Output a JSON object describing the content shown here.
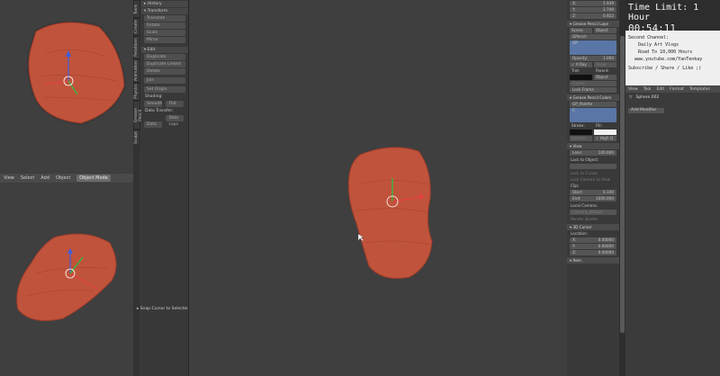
{
  "colors": {
    "mesh": "#c0533b",
    "mesh_dark": "#9e3c2a",
    "viewport": "#3f3f3f"
  },
  "header": {
    "items": [
      "View",
      "Select",
      "Add",
      "Object"
    ],
    "mode": "Object Mode"
  },
  "tabs": [
    "Tools",
    "Create",
    "Relations",
    "Animation",
    "Physics",
    "Grease Pencil",
    "Sculpt"
  ],
  "toolshelf": {
    "history": "History",
    "transform": "Transform",
    "transform_buttons": [
      "Translate",
      "Rotate",
      "Scale",
      "Mirror"
    ],
    "edit": "Edit",
    "edit_buttons": [
      "Duplicate",
      "Duplicate Linked",
      "Delete",
      "Join"
    ],
    "set_origin": "Set Origin",
    "shading": "Shading:",
    "shading_buttons": [
      "Smooth",
      "Flat"
    ],
    "data_transfer": "Data Transfer:",
    "data_buttons": [
      "Data",
      "Data Layo"
    ]
  },
  "snap": "Snap Cursor to Selected",
  "props": {
    "coords_top": [
      {
        "axis": "X:",
        "val": "1.939"
      },
      {
        "axis": "Y:",
        "val": "2.749"
      },
      {
        "axis": "Z:",
        "val": "0.922"
      }
    ],
    "gp_layers": "Grease Pencil Laye",
    "scene_obj": [
      "Scene",
      "Object"
    ],
    "gpencil": "GPencil",
    "gp": "GP",
    "opacity": "Opacity:",
    "opacity_val": "1.000",
    "xray": "X Ray",
    "show": "Show",
    "tint": "Tint:",
    "parent": "Parent:",
    "object": "Object",
    "frame": "Frame:",
    "lock_frame": "Lock Frame",
    "gp_colors": "Grease Pencil Colors",
    "palette": "GP_Palette",
    "color_c": "C",
    "stroke": "Stroke:",
    "fill": "Fill:",
    "volume": "Volume",
    "high_q": "High Q",
    "view": "View",
    "lens": "Lens:",
    "lens_val": "100.000",
    "lock_obj": "Lock to Object:",
    "lock_cursor": "Lock to Cursor",
    "lock_camera": "Lock Camera to View",
    "clip": "Clip:",
    "start": "Start:",
    "start_val": "0.100",
    "end": "End:",
    "end_val": "1000.000",
    "local_camera": "Local Camera:",
    "camera": "Camera_default",
    "render_border": "Render Border",
    "cursor3d": "3D Cursor",
    "location": "Location:",
    "cursor": [
      {
        "axis": "X:",
        "val": "0.00000"
      },
      {
        "axis": "Y:",
        "val": "0.00000"
      },
      {
        "axis": "Z:",
        "val": "0.00000"
      }
    ],
    "item": "Item"
  },
  "note": {
    "time_limit": "Time Limit: 1 Hour",
    "timer": "00:54:11",
    "second_channel": "Second Channel:",
    "vlog": "Daily Art Vlogs",
    "road": "Road To 10,000 Hours",
    "url": "www.youtube.com/YanTenkay",
    "cta": "Subscribe / Share / Like ;)"
  },
  "outliner": {
    "menu": [
      "View",
      "Tool",
      "Edit",
      "Format",
      "Templates"
    ],
    "object": "Sphere.002",
    "add_modifier": "Add Modifier"
  }
}
